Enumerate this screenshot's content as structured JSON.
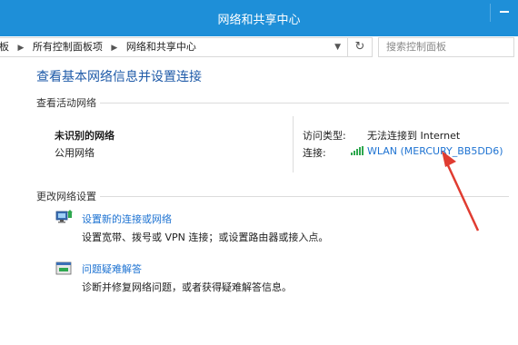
{
  "window": {
    "title": "网络和共享中心"
  },
  "address": {
    "crumbs": [
      "板",
      "所有控制面板项",
      "网络和共享中心"
    ],
    "search_placeholder": "搜索控制面板"
  },
  "main": {
    "heading": "查看基本网络信息并设置连接",
    "active_section": "查看活动网络",
    "network_name": "未识别的网络",
    "network_type": "公用网络",
    "access_label": "访问类型:",
    "access_value": "无法连接到 Internet",
    "conn_label": "连接:",
    "conn_value": "WLAN (MERCURY_BB5DD6)",
    "change_section": "更改网络设置",
    "tasks": [
      {
        "link": "设置新的连接或网络",
        "desc": "设置宽带、拨号或 VPN 连接；或设置路由器或接入点。"
      },
      {
        "link": "问题疑难解答",
        "desc": "诊断并修复网络问题，或者获得疑难解答信息。"
      }
    ]
  },
  "colors": {
    "titlebar": "#1e8fd8",
    "link": "#1e73d2",
    "arrow": "#e03c31"
  }
}
